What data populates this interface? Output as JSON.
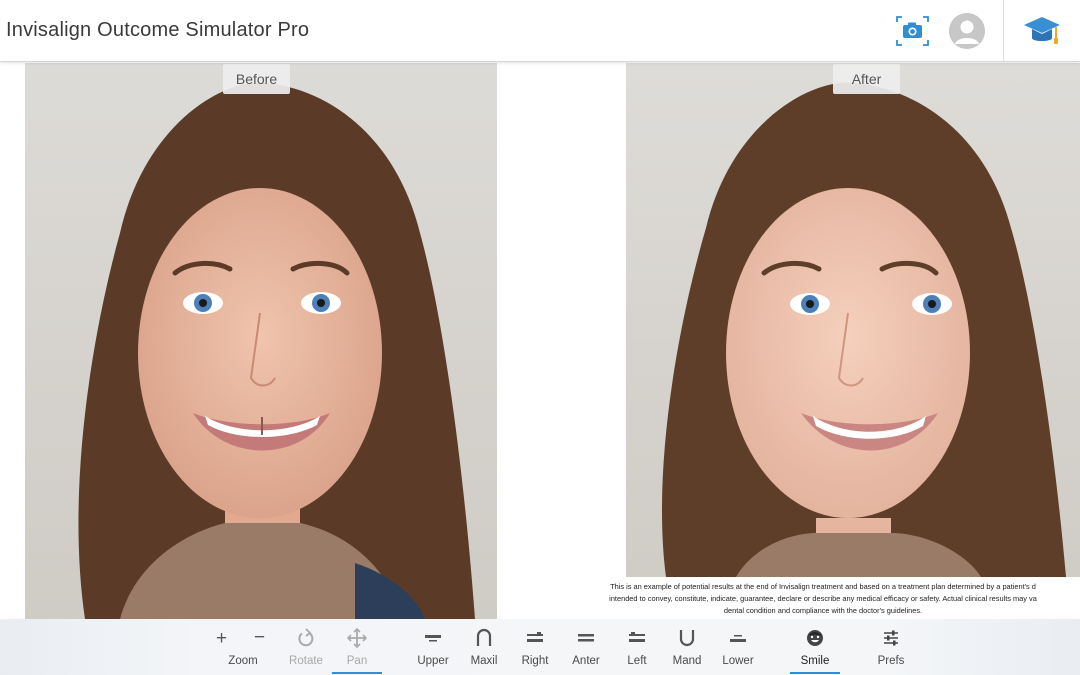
{
  "header": {
    "title": "Invisalign Outcome Simulator Pro",
    "camera_icon": "camera-icon",
    "avatar_icon": "user-avatar-icon",
    "learn_icon": "graduation-cap-icon"
  },
  "photos": {
    "before_label": "Before",
    "after_label": "After"
  },
  "disclaimer": {
    "line1": "This is an example of potential results at the end of Invisalign treatment and based on a treatment plan determined by a patient's d",
    "line2": "intended to convey, constitute, indicate, guarantee, declare or describe any medical efficacy or safety. Actual clinical results may va",
    "line3": "dental condition and compliance with the doctor's guidelines."
  },
  "toolbar": {
    "zoom": {
      "label": "Zoom",
      "plus": "+",
      "minus": "−"
    },
    "rotate": {
      "label": "Rotate",
      "icon": "rotate-icon",
      "state": "disabled"
    },
    "pan": {
      "label": "Pan",
      "icon": "pan-arrows-icon",
      "state": "active"
    },
    "upper": {
      "label": "Upper",
      "icon": "upper-arch-icon"
    },
    "maxil": {
      "label": "Maxil",
      "icon": "maxillary-arch-icon"
    },
    "right": {
      "label": "Right",
      "icon": "right-view-icon"
    },
    "anter": {
      "label": "Anter",
      "icon": "anterior-view-icon"
    },
    "left": {
      "label": "Left",
      "icon": "left-view-icon"
    },
    "mand": {
      "label": "Mand",
      "icon": "mandibular-arch-icon"
    },
    "lower": {
      "label": "Lower",
      "icon": "lower-arch-icon"
    },
    "smile": {
      "label": "Smile",
      "icon": "smile-face-icon",
      "state": "selected"
    },
    "prefs": {
      "label": "Prefs",
      "icon": "sliders-icon"
    }
  },
  "colors": {
    "accent": "#2f8fd6",
    "photo_background": "#d9d7d3",
    "hair": "#5a3a26",
    "skin_before": "#e8b79e",
    "skin_after": "#eec3ae",
    "sweater": "#9a7b68"
  }
}
